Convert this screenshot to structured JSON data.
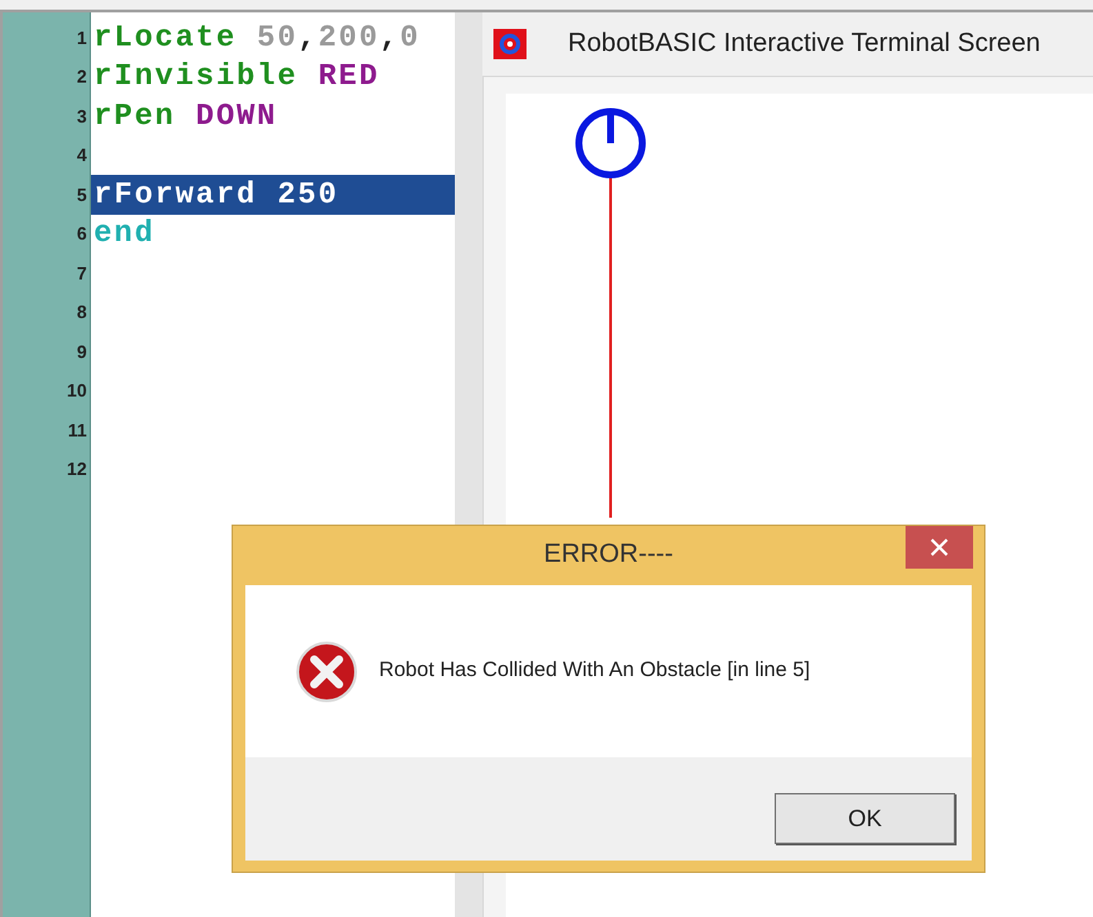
{
  "editor": {
    "lines": [
      {
        "number": "1",
        "selected": false,
        "tokens": [
          {
            "text": "rLocate",
            "kind": "command"
          },
          {
            "text": " 50",
            "kind": "number"
          },
          {
            "text": ",",
            "kind": "punct"
          },
          {
            "text": "200",
            "kind": "number"
          },
          {
            "text": ",",
            "kind": "punct"
          },
          {
            "text": "0",
            "kind": "number"
          }
        ]
      },
      {
        "number": "2",
        "selected": false,
        "tokens": [
          {
            "text": "rInvisible",
            "kind": "command"
          },
          {
            "text": " RED",
            "kind": "constant"
          }
        ]
      },
      {
        "number": "3",
        "selected": false,
        "tokens": [
          {
            "text": "rPen",
            "kind": "command"
          },
          {
            "text": " DOWN",
            "kind": "constant"
          }
        ]
      },
      {
        "number": "4",
        "selected": false
      },
      {
        "number": "5",
        "selected": true,
        "tokens": [
          {
            "text": "rForward",
            "kind": "command"
          },
          {
            "text": " 250",
            "kind": "number"
          }
        ]
      },
      {
        "number": "6",
        "selected": false,
        "tokens": [
          {
            "text": "end",
            "kind": "keyword"
          }
        ]
      },
      {
        "number": "7",
        "selected": false
      },
      {
        "number": "8",
        "selected": false
      },
      {
        "number": "9",
        "selected": false
      },
      {
        "number": "10",
        "selected": false
      },
      {
        "number": "11",
        "selected": false
      },
      {
        "number": "12",
        "selected": false
      }
    ]
  },
  "terminal": {
    "title": "RobotBASIC Interactive Terminal Screen"
  },
  "dialog": {
    "title": "ERROR----",
    "message": "Robot Has Collided With An Obstacle [in line 5]",
    "buttons": [
      "OK"
    ]
  }
}
